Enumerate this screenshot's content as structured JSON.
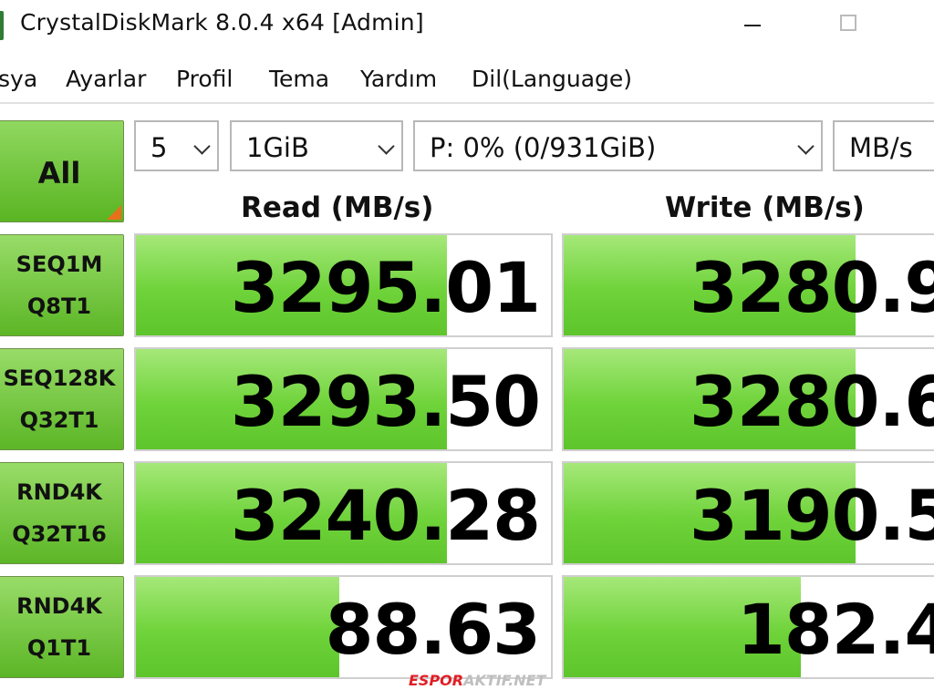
{
  "window": {
    "title": "CrystalDiskMark 8.0.4 x64 [Admin]",
    "minimize_icon": "minimize-icon",
    "maximize_icon": "maximize-icon"
  },
  "menu": {
    "items": [
      "sya",
      "Ayarlar",
      "Profil",
      "Tema",
      "Yardım",
      "Dil(Language)"
    ]
  },
  "controls": {
    "all_label": "All",
    "count": "5",
    "size": "1GiB",
    "drive": "P: 0% (0/931GiB)",
    "unit": "MB/s"
  },
  "headers": {
    "read": "Read (MB/s)",
    "write": "Write (MB/s)"
  },
  "results": [
    {
      "line1": "SEQ1M",
      "line2": "Q8T1",
      "read": "3295.01",
      "write": "3280.9",
      "read_fill": 0.75,
      "write_fill": 0.75
    },
    {
      "line1": "SEQ128K",
      "line2": "Q32T1",
      "read": "3293.50",
      "write": "3280.6",
      "read_fill": 0.75,
      "write_fill": 0.75
    },
    {
      "line1": "RND4K",
      "line2": "Q32T16",
      "read": "3240.28",
      "write": "3190.5",
      "read_fill": 0.75,
      "write_fill": 0.75
    },
    {
      "line1": "RND4K",
      "line2": "Q1T1",
      "read": "88.63",
      "write": "182.4",
      "read_fill": 0.49,
      "write_fill": 0.61
    }
  ],
  "colors": {
    "bar_green": "#6fd33a",
    "label_green": "#5cb626",
    "corner_orange": "#e8701a"
  },
  "watermark": {
    "part1": "ESPOR",
    "part2": "AKTIF.NET"
  }
}
